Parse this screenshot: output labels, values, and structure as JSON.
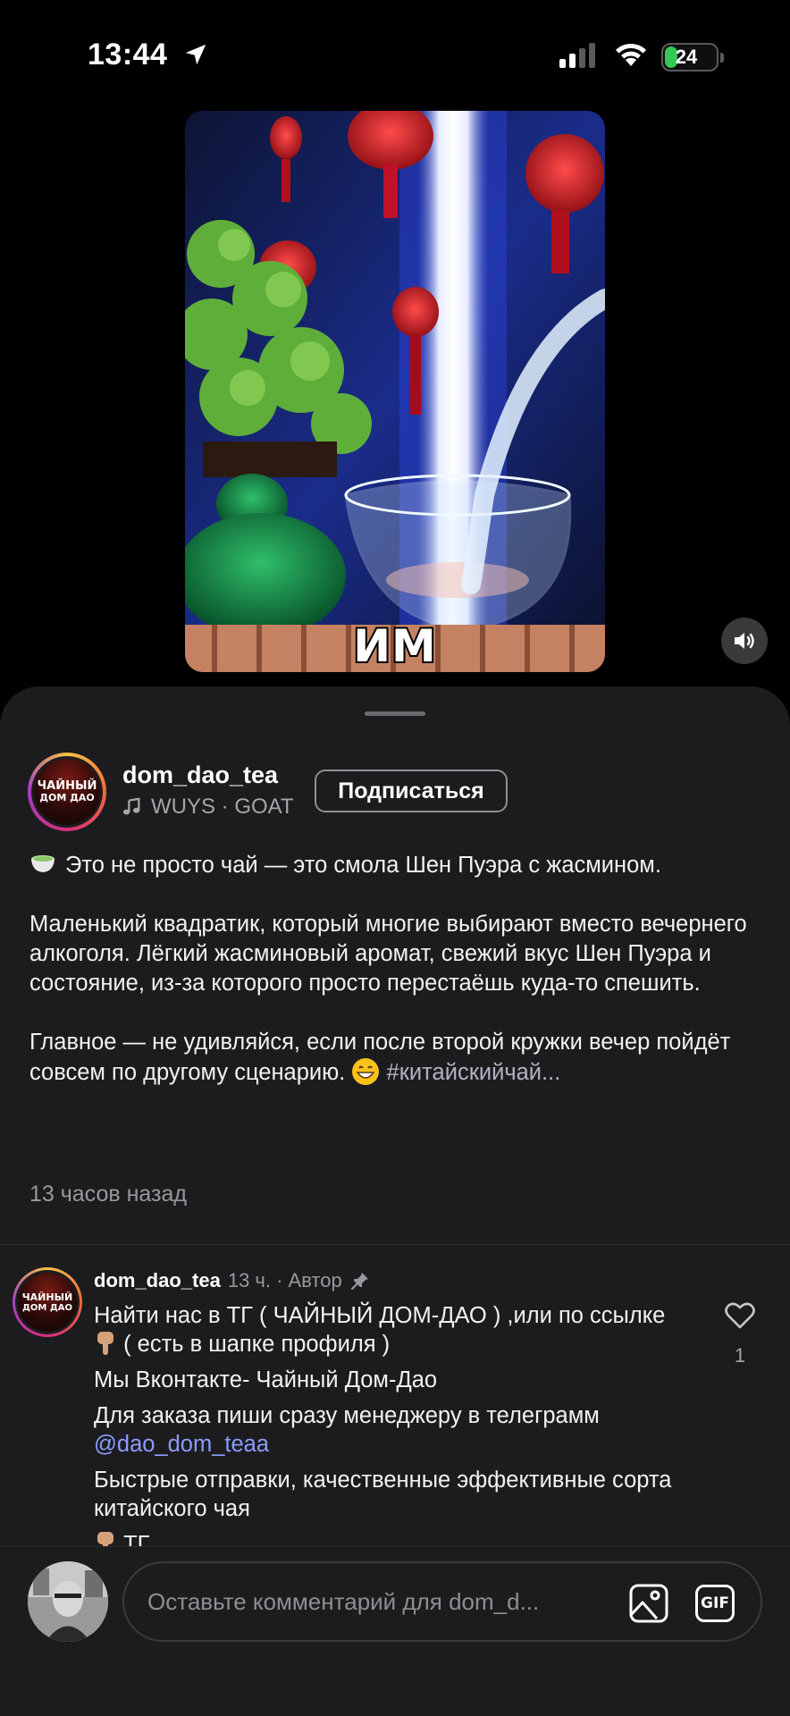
{
  "status_bar": {
    "time": "13:44",
    "battery": "24",
    "battery_level": 0.24
  },
  "video": {
    "caption": "ИМ",
    "mute_icon": "speaker-icon"
  },
  "post": {
    "avatar_text_line1": "ЧАЙНЫЙ",
    "avatar_text_line2": "ДОМ ДАО",
    "username": "dom_dao_tea",
    "music": "WUYS · GOAT",
    "subscribe_label": "Подписаться",
    "caption_p1": "Это не просто чай — это смола Шен Пуэра с жасмином.",
    "caption_p2": "Маленький квадратик, который многие выбирают вместо вечернего алкоголя. Лёгкий жасминовый аромат, свежий вкус Шен Пуэра и состояние, из-за которого просто перестаёшь куда-то спешить.",
    "caption_p3": "Главное — не удивляйся, если после второй кружки вечер пойдёт совсем по другому сценарию.",
    "caption_hashtag": "#китайскийчай...",
    "time_ago": "13 часов назад"
  },
  "comment": {
    "username": "dom_dao_tea",
    "meta": "13 ч. · Автор",
    "line1_a": "Найти нас в ТГ ( ЧАЙНЫЙ ДОМ-ДАО ) ,или по ссылке",
    "line1_b": "( есть в шапке профиля )",
    "line2": "Мы Вконтакте- Чайный Дом-Дао",
    "line3": "Для заказа пиши сразу менеджеру в телеграмм",
    "mention": "@dao_dom_teaa",
    "line4": "Быстрые отправки, качественные эффективные сорта китайского чая",
    "line5": "ТГ",
    "likes": "1"
  },
  "composer": {
    "placeholder": "Оставьте комментарий для dom_d...",
    "gif_label": "GIF"
  },
  "colors": {
    "background": "#000000",
    "sheet": "#1c1c1f",
    "mention": "#8b9cff",
    "battery_green": "#34c759"
  }
}
